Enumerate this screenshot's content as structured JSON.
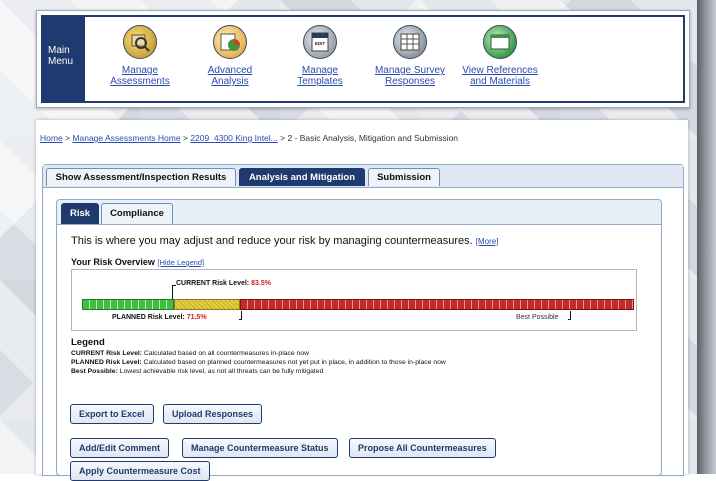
{
  "menu": {
    "main_label_line1": "Main",
    "main_label_line2": "Menu",
    "items": [
      {
        "line1": "Manage",
        "line2": "Assessments",
        "icon": "magnifier-map-icon"
      },
      {
        "line1": "Advanced",
        "line2": "Analysis",
        "icon": "pie-chart-icon"
      },
      {
        "line1": "Manage",
        "line2": "Templates",
        "icon": "template-edit-icon",
        "icon_text": "EDIT"
      },
      {
        "line1": "Manage Survey",
        "line2": "Responses",
        "icon": "survey-grid-icon"
      },
      {
        "line1": "View References",
        "line2": "and Materials",
        "icon": "reference-window-icon"
      }
    ]
  },
  "breadcrumb": {
    "home": "Home",
    "sep": ">",
    "assessments": "Manage Assessments Home",
    "intel": "2209_4300 King Intel...",
    "current": "2 - Basic Analysis, Mitigation and Submission"
  },
  "tabs": {
    "results": "Show Assessment/Inspection Results",
    "analysis": "Analysis and Mitigation",
    "submission": "Submission"
  },
  "subtabs": {
    "risk": "Risk",
    "compliance": "Compliance"
  },
  "intro": {
    "text": "This is where you may adjust and reduce your risk by managing countermeasures.",
    "more": "[More]"
  },
  "overview": {
    "title": "Your Risk Overview",
    "hide_legend": "[Hide Legend]"
  },
  "risk": {
    "current_label": "CURRENT Risk Level:",
    "current_value": "83.5%",
    "planned_label": "PLANNED Risk Level:",
    "planned_value": "71.5%",
    "best_possible": "Best Possible",
    "current_fraction": 0.835,
    "planned_fraction": 0.715
  },
  "legend": {
    "title": "Legend",
    "current_term": "CURRENT Risk Level:",
    "current_desc": " Calculated based on all countermeasures in-place now",
    "planned_term": "PLANNED Risk Level:",
    "planned_desc": " Calculated based on planned countermeasures not yet put in place, in addition to those in-place now",
    "best_term": "Best Possible:",
    "best_desc": " Lowest achievable risk level, as not all threats can be fully mitigated"
  },
  "buttons": {
    "export": "Export to Excel",
    "upload": "Upload Responses",
    "comment": "Add/Edit Comment",
    "status": "Manage Countermeasure Status",
    "propose": "Propose All Countermeasures",
    "cost": "Apply Countermeasure Cost"
  },
  "colors": {
    "navy": "#1f3a6e",
    "link": "#2a4bb0",
    "current_green": "#3fbf3f",
    "planned_yellow": "#e8cf40",
    "remaining_red": "#c42a2a",
    "percent_red": "#d02020"
  }
}
